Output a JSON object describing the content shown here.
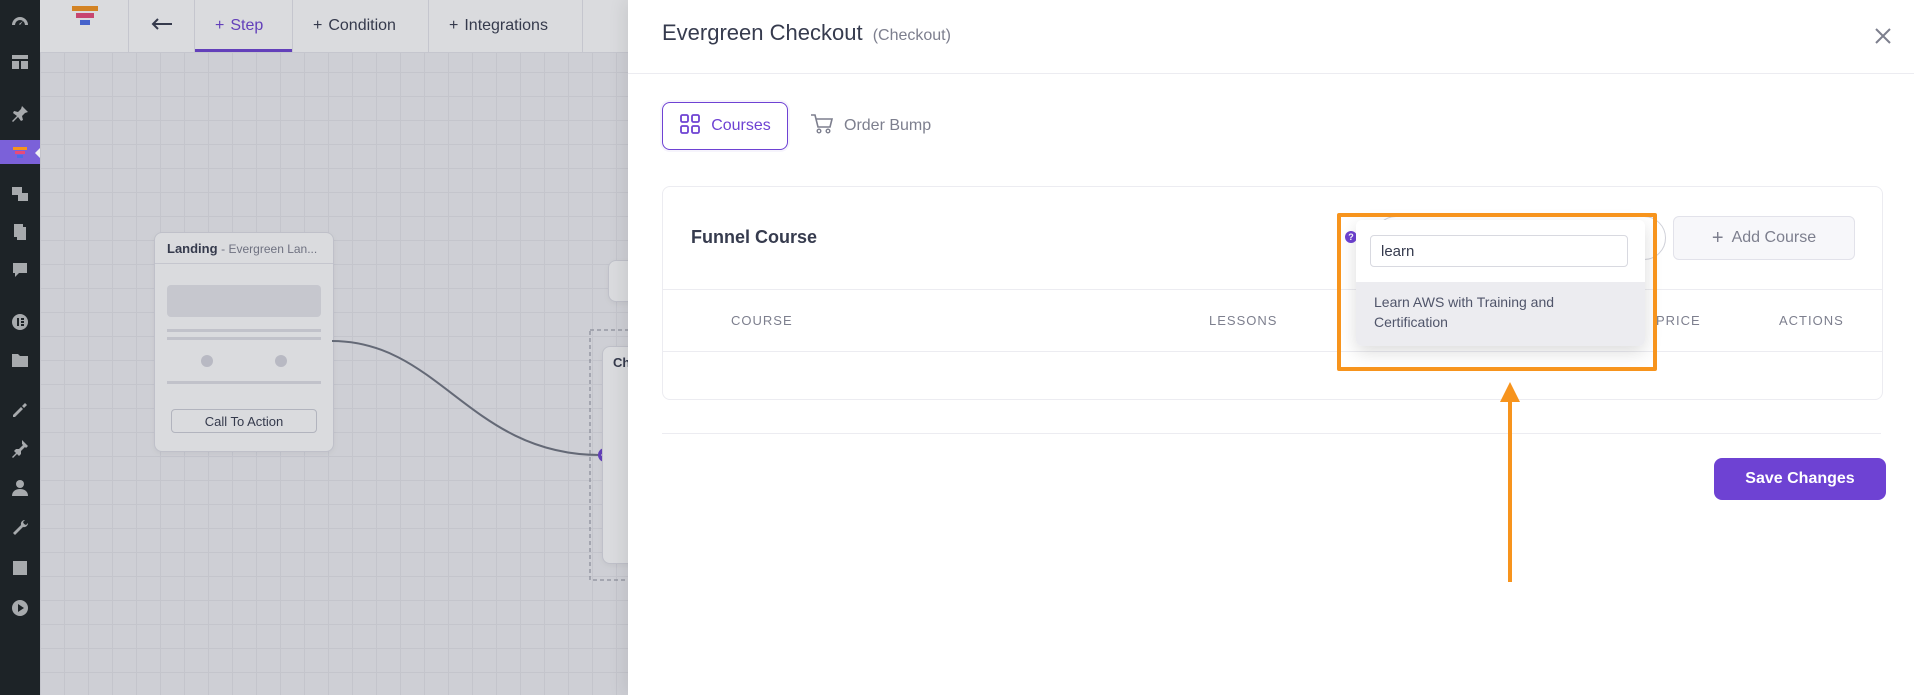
{
  "canvas": {
    "toolbar": {
      "step_label": "Step",
      "condition_label": "Condition",
      "integrations_label": "Integrations"
    },
    "landing_node": {
      "title": "Landing",
      "subtitle": "- Evergreen Lan...",
      "cta": "Call To Action"
    },
    "checkout_node_partial": "Ch"
  },
  "drawer": {
    "title": "Evergreen Checkout",
    "subtitle": "(Checkout)",
    "tabs": [
      {
        "label": "Courses",
        "icon": "grid-icon"
      },
      {
        "label": "Order Bump",
        "icon": "cart-icon"
      }
    ],
    "card": {
      "title": "Funnel Course",
      "add_course_label": "Add Course",
      "columns": [
        "COURSE",
        "LESSONS",
        "PRICE",
        "ACTIONS"
      ]
    },
    "dropdown": {
      "search_value": "learn",
      "options": [
        "Learn AWS with Training and Certification"
      ]
    },
    "save_label": "Save Changes"
  },
  "colors": {
    "accent": "#6e42d3",
    "highlight": "#f7941d",
    "wp_sidebar": "#1d2327"
  }
}
